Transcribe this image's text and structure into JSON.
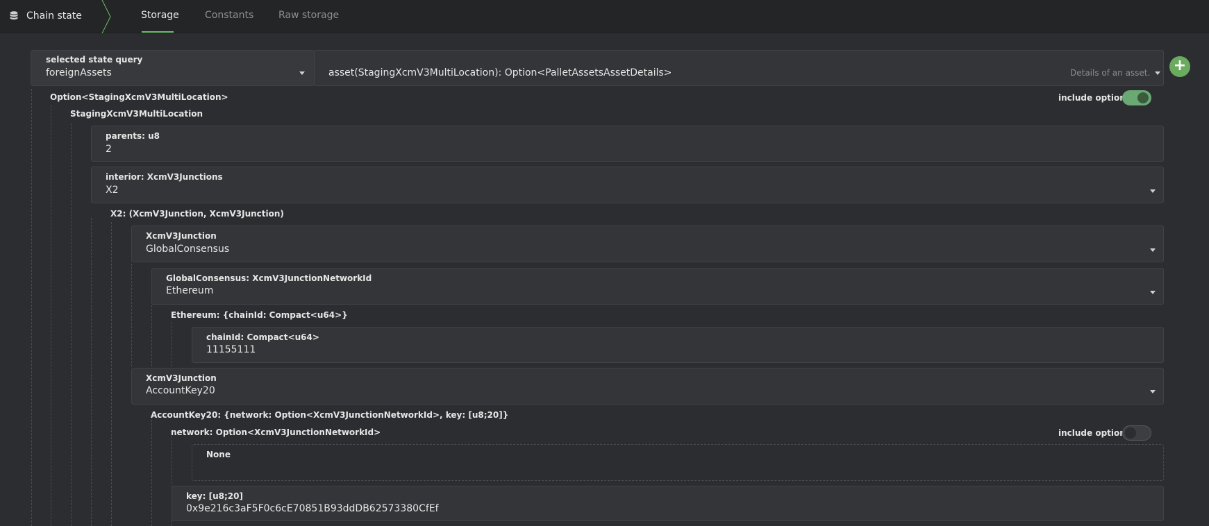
{
  "header": {
    "app_title": "Chain state",
    "tabs": [
      {
        "label": "Storage",
        "active": true
      },
      {
        "label": "Constants",
        "active": false
      },
      {
        "label": "Raw storage",
        "active": false
      }
    ]
  },
  "query": {
    "selector_label": "selected state query",
    "selector_value": "foreignAssets",
    "method_signature": "asset(StagingXcmV3MultiLocation): Option<PalletAssetsAssetDetails>",
    "method_hint": "Details of an asset."
  },
  "params": {
    "option_label": "Option<StagingXcmV3MultiLocation>",
    "include_option_label": "include option",
    "multilocation_label": "StagingXcmV3MultiLocation",
    "parents": {
      "label": "parents: u8",
      "value": "2"
    },
    "interior": {
      "label": "interior: XcmV3Junctions",
      "value": "X2"
    },
    "x2_label": "X2: (XcmV3Junction, XcmV3Junction)",
    "junction1": {
      "label": "XcmV3Junction",
      "value": "GlobalConsensus"
    },
    "global_consensus": {
      "label": "GlobalConsensus: XcmV3JunctionNetworkId",
      "value": "Ethereum"
    },
    "ethereum_label": "Ethereum: {chainId: Compact<u64>}",
    "chain_id": {
      "label": "chainId: Compact<u64>",
      "value": "11155111"
    },
    "junction2": {
      "label": "XcmV3Junction",
      "value": "AccountKey20"
    },
    "account_key20_label": "AccountKey20: {network: Option<XcmV3JunctionNetworkId>, key: [u8;20]}",
    "network_label": "network: Option<XcmV3JunctionNetworkId>",
    "network_include_option_label": "include option",
    "network_none": "None",
    "key": {
      "label": "key: [u8;20]",
      "value": "0x9e216c3aF5F0c6cE70851B93ddDB62573380CfEf"
    }
  },
  "colors": {
    "accent": "#6cbf6c",
    "add_button": "#6aab5f",
    "toggle_on": "#6aa874"
  },
  "icons": [
    "database-icon",
    "plus-icon",
    "chevron-down-icon"
  ]
}
